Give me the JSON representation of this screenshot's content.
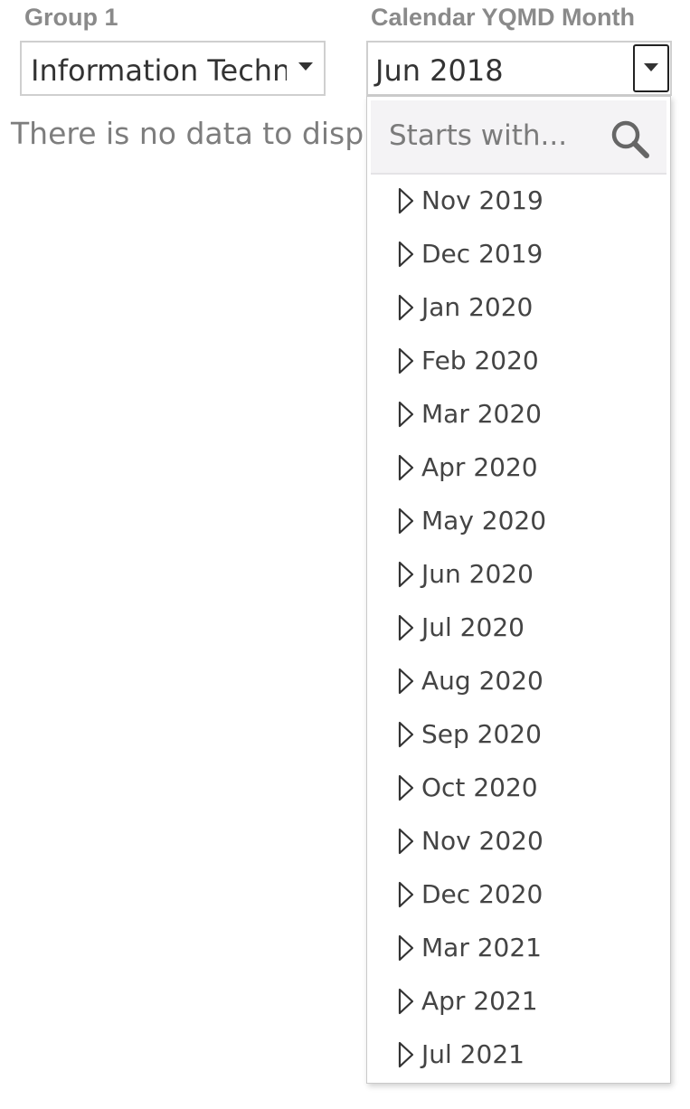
{
  "filters": {
    "group": {
      "label": "Group 1",
      "selected_value": "Information Technology"
    },
    "calendar": {
      "label": "Calendar YQMD Month",
      "selected_value": "Jun 2018"
    }
  },
  "main": {
    "empty_message": "There is no data to display"
  },
  "dropdown": {
    "search_placeholder": "Starts with...",
    "items": [
      {
        "label": "Nov 2019"
      },
      {
        "label": "Dec 2019"
      },
      {
        "label": "Jan 2020"
      },
      {
        "label": "Feb 2020"
      },
      {
        "label": "Mar 2020"
      },
      {
        "label": "Apr 2020"
      },
      {
        "label": "May 2020"
      },
      {
        "label": "Jun 2020"
      },
      {
        "label": "Jul 2020"
      },
      {
        "label": "Aug 2020"
      },
      {
        "label": "Sep 2020"
      },
      {
        "label": "Oct 2020"
      },
      {
        "label": "Nov 2020"
      },
      {
        "label": "Dec 2020"
      },
      {
        "label": "Mar 2021"
      },
      {
        "label": "Apr 2021"
      },
      {
        "label": "Jul 2021"
      }
    ]
  },
  "colors": {
    "label_gray": "#8a8a8a",
    "text_dark": "#333333",
    "search_bg": "#f4f3f5",
    "border": "#cfcfcf"
  },
  "icons": {
    "search": "search-icon",
    "caret": "caret-down-icon",
    "expand": "triangle-right-icon"
  }
}
